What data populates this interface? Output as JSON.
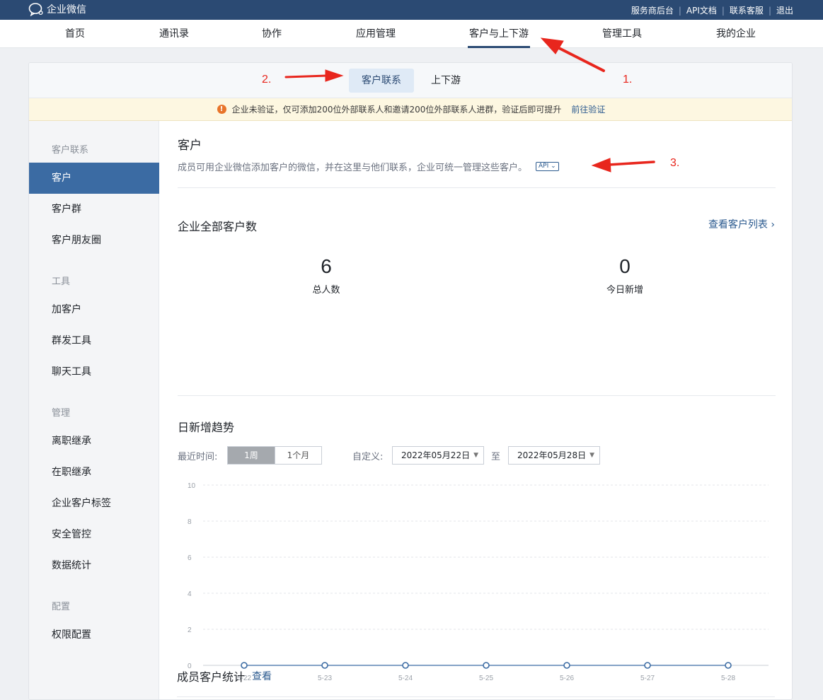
{
  "topbar": {
    "logo_text": "企业微信",
    "links": [
      "服务商后台",
      "API文档",
      "联系客服",
      "退出"
    ]
  },
  "mainnav": {
    "items": [
      "首页",
      "通讯录",
      "协作",
      "应用管理",
      "客户与上下游",
      "管理工具",
      "我的企业"
    ],
    "active_index": 4
  },
  "subnav": {
    "tabs": [
      "客户联系",
      "上下游"
    ],
    "active_index": 0
  },
  "notice": {
    "text": "企业未验证，仅可添加200位外部联系人和邀请200位外部联系人进群，验证后即可提升",
    "link": "前往验证"
  },
  "sidebar": {
    "groups": [
      {
        "title": "客户联系",
        "items": [
          "客户",
          "客户群",
          "客户朋友圈"
        ]
      },
      {
        "title": "工具",
        "items": [
          "加客户",
          "群发工具",
          "聊天工具"
        ]
      },
      {
        "title": "管理",
        "items": [
          "离职继承",
          "在职继承",
          "企业客户标签",
          "安全管控",
          "数据统计"
        ]
      },
      {
        "title": "配置",
        "items": [
          "权限配置"
        ]
      }
    ],
    "active_item": "客户"
  },
  "main": {
    "title": "客户",
    "description": "成员可用企业微信添加客户的微信，并在这里与他们联系，企业可统一管理这些客户。",
    "api_badge": "API",
    "total_section": {
      "title": "企业全部客户数",
      "link": "查看客户列表",
      "stats": [
        {
          "value": "6",
          "label": "总人数"
        },
        {
          "value": "0",
          "label": "今日新增"
        }
      ]
    },
    "trend": {
      "title": "日新增趋势",
      "recent_label": "最近时间:",
      "range_buttons": [
        "1周",
        "1个月"
      ],
      "active_range": 0,
      "custom_label": "自定义:",
      "start_date": "2022年05月22日",
      "to_label": "至",
      "end_date": "2022年05月28日"
    },
    "member_stats": {
      "title": "成员客户统计",
      "link": "查看"
    }
  },
  "chart_data": {
    "type": "line",
    "x": [
      "5-22",
      "5-23",
      "5-24",
      "5-25",
      "5-26",
      "5-27",
      "5-28"
    ],
    "series": [
      {
        "values": [
          0,
          0,
          0,
          0,
          0,
          0,
          0
        ]
      }
    ],
    "yticks": [
      0,
      2,
      4,
      6,
      8,
      10
    ],
    "ylim": [
      0,
      10
    ],
    "grid": true,
    "line_color": "#3b6ba3"
  },
  "annotations": {
    "labels": [
      "1.",
      "2.",
      "3."
    ],
    "color": "#e8261d"
  }
}
